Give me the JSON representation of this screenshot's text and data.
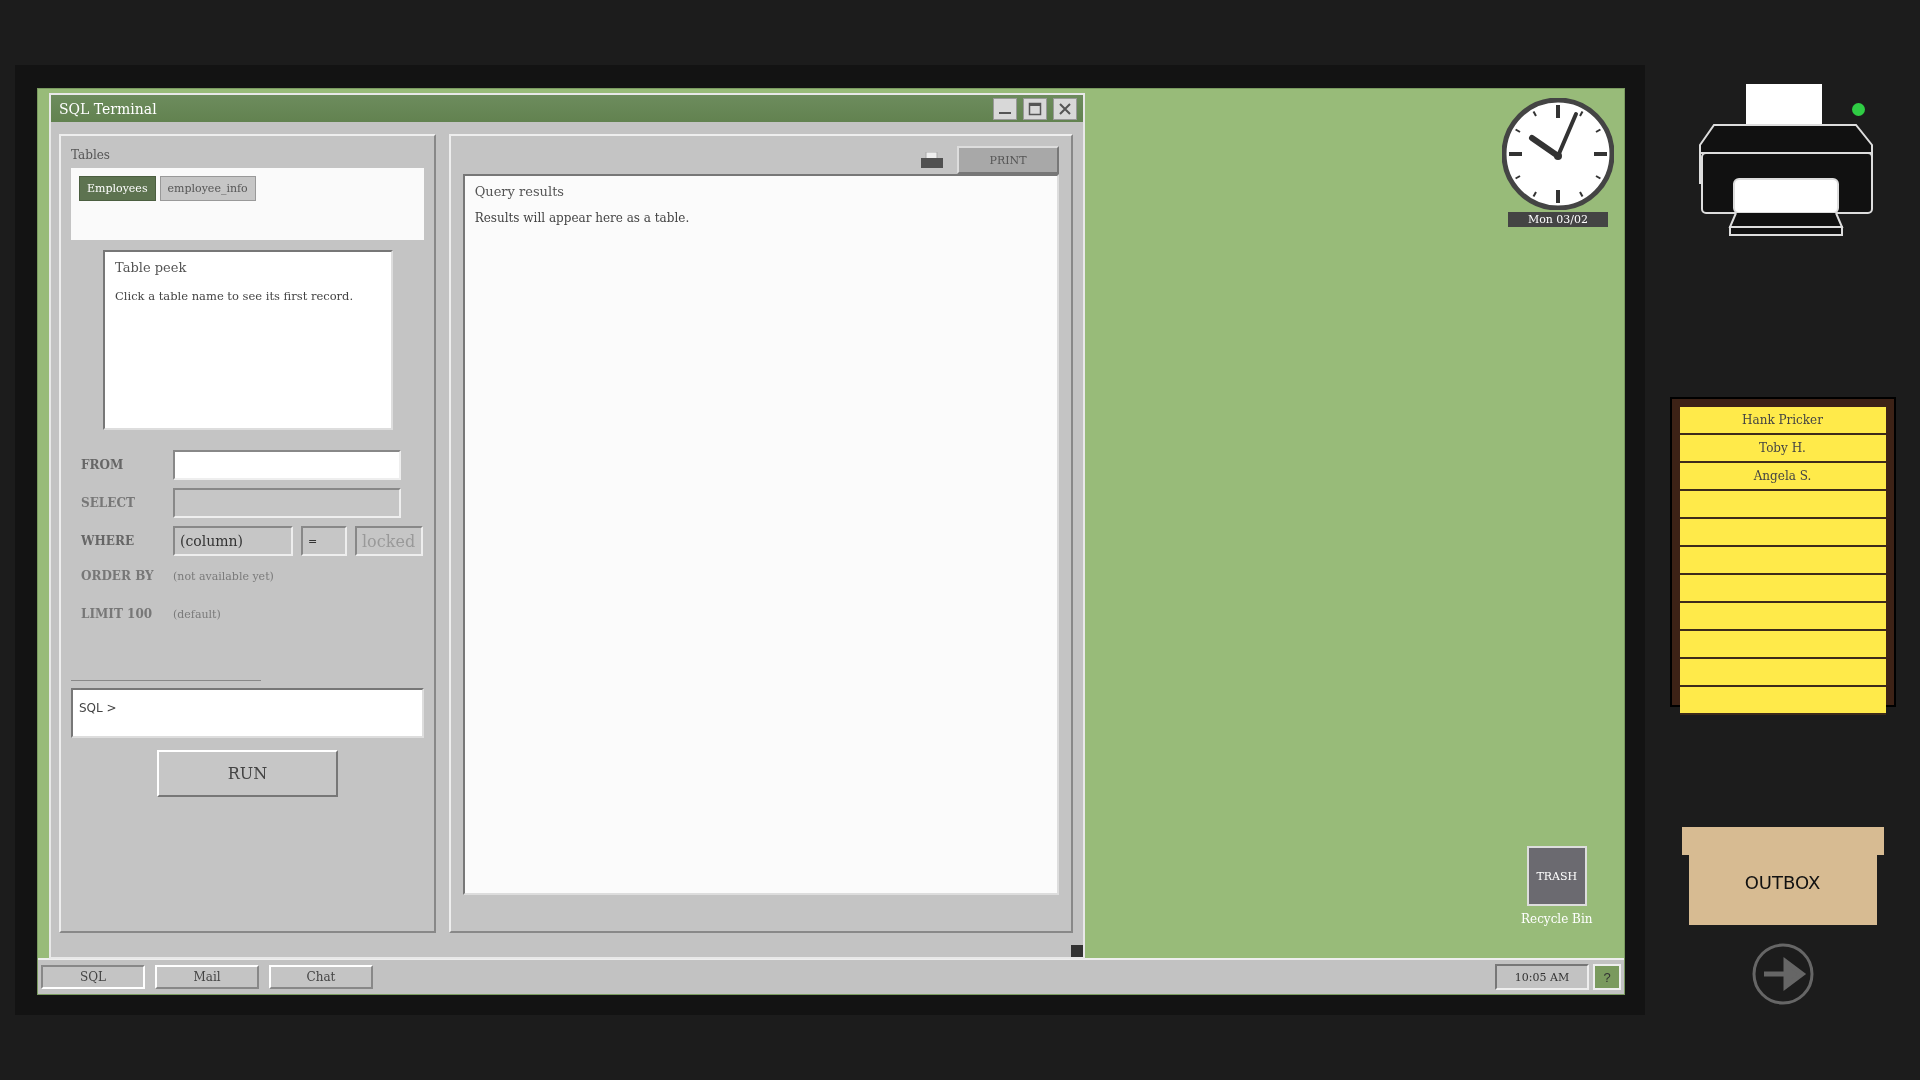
{
  "window": {
    "title": "SQL Terminal"
  },
  "tables": {
    "label": "Tables",
    "items": [
      {
        "label": "Employees",
        "selected": true
      },
      {
        "label": "employee_info",
        "selected": false
      }
    ]
  },
  "table_peek": {
    "title": "Table peek",
    "text": "Click a table name to see its first record."
  },
  "query_builder": [
    {
      "kind": "field",
      "label": "FROM",
      "disabled": false
    },
    {
      "kind": "field",
      "label": "SELECT",
      "disabled": true
    },
    {
      "kind": "where",
      "label": "WHERE",
      "column": "(column)",
      "operator": "=",
      "placeholder": "locked",
      "disabled": false
    },
    {
      "kind": "note",
      "label": "ORDER BY",
      "note": "(not available yet)",
      "disabled": true
    },
    {
      "kind": "note",
      "label": "LIMIT 100",
      "note": "(default)",
      "disabled": true
    }
  ],
  "sql_prompt": "SQL >",
  "run_button": "RUN",
  "print_button": "PRINT",
  "results": {
    "title": "Query results",
    "text": "Results will appear here as a table."
  },
  "desktop": {
    "date": "Mon 03/02",
    "trash_icon": "TRASH",
    "trash_label": "Recycle Bin"
  },
  "taskbar": {
    "tabs": [
      {
        "label": "SQL",
        "selected": true
      },
      {
        "label": "Mail",
        "selected": false
      },
      {
        "label": "Chat",
        "selected": false
      }
    ],
    "time": "10:05 AM",
    "help": "?"
  },
  "printer": {
    "on": true
  },
  "clipboard": {
    "entries": [
      "Hank Pricker",
      "Toby H.",
      "Angela S."
    ]
  },
  "outbox": {
    "label": "OUTBOX"
  }
}
